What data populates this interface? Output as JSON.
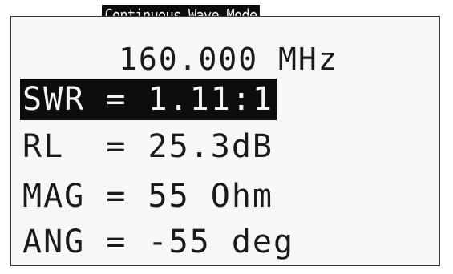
{
  "screen": {
    "title": "Continuous Wave Mode",
    "frequency": "160.000 MHz",
    "readings": [
      {
        "text": "SWR = 1.11:1",
        "selected": true
      },
      {
        "text": "RL  = 25.3dB",
        "selected": false
      },
      {
        "text": "MAG = 55 Ohm",
        "selected": false
      },
      {
        "text": "ANG = -55 deg",
        "selected": false
      }
    ]
  }
}
